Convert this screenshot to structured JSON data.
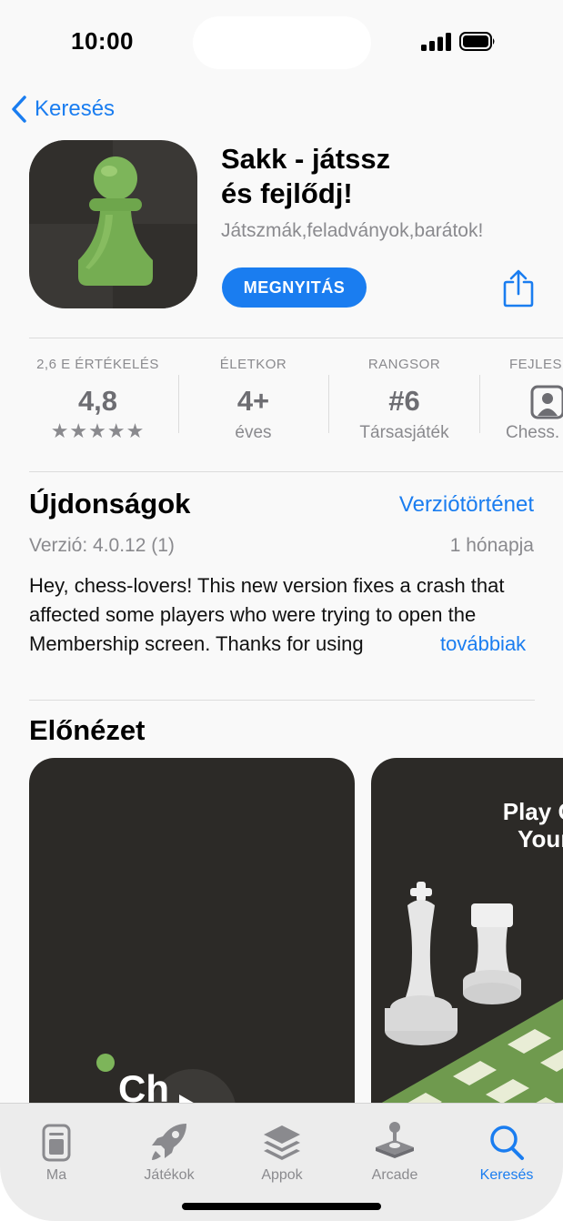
{
  "status_bar": {
    "time": "10:00"
  },
  "nav": {
    "back_label": "Keresés"
  },
  "app": {
    "title_line1": "Sakk - játssz",
    "title_line2": "és fejlődj!",
    "subtitle": "Játszmák,feladványok,barátok!",
    "open_label": "MEGNYITÁS",
    "accent_color": "#1a7df0",
    "icon": "chess-pawn-icon"
  },
  "stats": [
    {
      "label": "2,6 E ÉRTÉKELÉS",
      "value": "4,8",
      "sub": "★★★★★",
      "stars": 5
    },
    {
      "label": "ÉLETKOR",
      "value": "4+",
      "sub": "éves"
    },
    {
      "label": "RANGSOR",
      "value": "#6",
      "sub": "Társasjáték"
    },
    {
      "label": "FEJLES",
      "value": "",
      "sub": "Chess."
    }
  ],
  "whats_new": {
    "title": "Újdonságok",
    "history_link": "Verziótörténet",
    "version": "Verzió: 4.0.12 (1)",
    "age": "1 hónapja",
    "notes": "Hey, chess-lovers! This new version fixes a crash that affected some players who were trying to open the Membership screen. Thanks for using",
    "more_link": "továbbiak"
  },
  "preview": {
    "title": "Előnézet",
    "shot2_caption_line1": "Play Onli",
    "shot2_caption_line2": "Your Le"
  },
  "tabbar": [
    {
      "label": "Ma",
      "icon": "today-icon"
    },
    {
      "label": "Játékok",
      "icon": "rocket-icon"
    },
    {
      "label": "Appok",
      "icon": "apps-stack-icon"
    },
    {
      "label": "Arcade",
      "icon": "joystick-icon"
    },
    {
      "label": "Keresés",
      "icon": "search-icon",
      "active": true
    }
  ]
}
